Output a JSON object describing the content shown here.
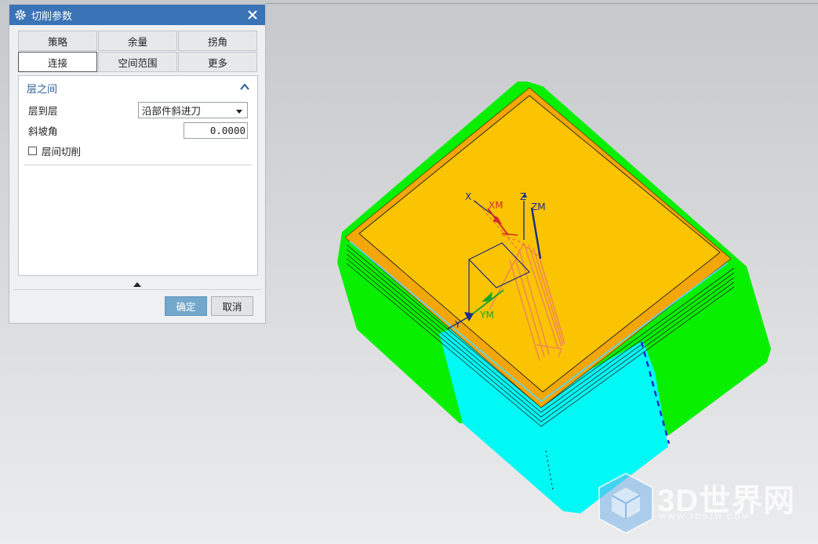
{
  "dialog": {
    "title": "切削参数",
    "tabs_row1": [
      "策略",
      "余量",
      "拐角"
    ],
    "tabs_row2": [
      "连接",
      "空间范围",
      "更多"
    ],
    "active_tab": "连接",
    "group_title": "层之间",
    "layer_to_layer_label": "层到层",
    "layer_to_layer_value": "沿部件斜进刀",
    "ramp_angle_label": "斜坡角",
    "ramp_angle_value": "0.0000",
    "interlayer_cut_label": "层间切削",
    "interlayer_cut_checked": false,
    "ok_label": "确定",
    "cancel_label": "取消"
  },
  "viewport": {
    "axis_labels": {
      "x": "X",
      "xm": "XM",
      "z": "Z",
      "zm": "ZM",
      "y": "Y",
      "ym": "YM"
    },
    "colors": {
      "top_face": "#fbc402",
      "wall_green": "#08f000",
      "wall_cyan": "#00f8f5",
      "toolpath": "#f08a50"
    }
  },
  "watermark": {
    "text": "3D世界网",
    "sub": "WWW.3DSJW.COM"
  }
}
